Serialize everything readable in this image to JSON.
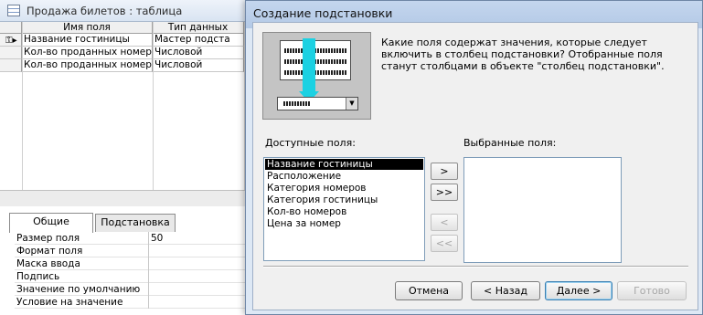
{
  "table_window": {
    "title": "Продажа билетов : таблица",
    "columns": [
      "Имя поля",
      "Тип данных"
    ],
    "rows": [
      {
        "name": "Название гостиницы",
        "type": "Мастер подста",
        "primary_key": true
      },
      {
        "name": "Кол-во проданных номеров",
        "type": "Числовой",
        "primary_key": false
      },
      {
        "name": "Кол-во проданных номеров",
        "type": "Числовой",
        "primary_key": false
      }
    ],
    "tabs": [
      "Общие",
      "Подстановка"
    ],
    "active_tab": "Общие",
    "properties": [
      {
        "label": "Размер поля",
        "value": "50"
      },
      {
        "label": "Формат поля",
        "value": ""
      },
      {
        "label": "Маска ввода",
        "value": ""
      },
      {
        "label": "Подпись",
        "value": ""
      },
      {
        "label": "Значение по умолчанию",
        "value": ""
      },
      {
        "label": "Условие на значение",
        "value": ""
      }
    ]
  },
  "wizard": {
    "title": "Создание подстановки",
    "description": "Какие поля содержат значения, которые следует включить в столбец подстановки? Отобранные поля станут столбцами в объекте \"столбец подстановки\".",
    "available_label": "Доступные поля:",
    "selected_label": "Выбранные поля:",
    "available_fields": [
      "Название гостиницы",
      "Расположение",
      "Категория номеров",
      "Категория гостиницы",
      "Кол-во номеров",
      "Цена за номер"
    ],
    "selected_index": 0,
    "selected_fields": [],
    "move_buttons": {
      "add_one": ">",
      "add_all": ">>",
      "remove_one": "<",
      "remove_all": "<<"
    },
    "nav_buttons": {
      "cancel": "Отмена",
      "back": "< Назад",
      "next": "Далее >",
      "finish": "Готово"
    }
  },
  "icons": {
    "table_icon": "table-icon",
    "key_icon": "primary-key-icon",
    "wizard_image": "lookup-wizard-illustration"
  },
  "colors": {
    "dialog_frame": "#dde8f5",
    "wizard_accent": "#1cd1e2",
    "selection": "#000000"
  }
}
